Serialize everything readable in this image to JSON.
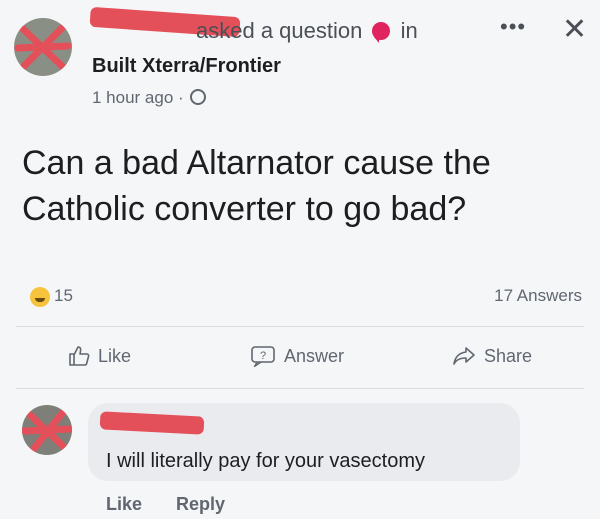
{
  "header": {
    "asked_text": "asked a question",
    "in_text": "in",
    "group_name": "Built Xterra/Frontier",
    "timestamp": "1 hour ago ·",
    "more_icon": "more-icon",
    "close_icon": "close-icon"
  },
  "question": {
    "text": "Can a bad Altarnator cause the Catholic converter to go bad?"
  },
  "stats": {
    "reaction_count": "15",
    "answers": "17 Answers"
  },
  "actions": {
    "like": "Like",
    "answer": "Answer",
    "share": "Share"
  },
  "comment": {
    "text": "I will literally pay for your vasectomy",
    "like": "Like",
    "reply": "Reply"
  },
  "colors": {
    "redaction": "#e4505a",
    "background": "#f5f6f7",
    "bubble": "#e9ebee"
  }
}
